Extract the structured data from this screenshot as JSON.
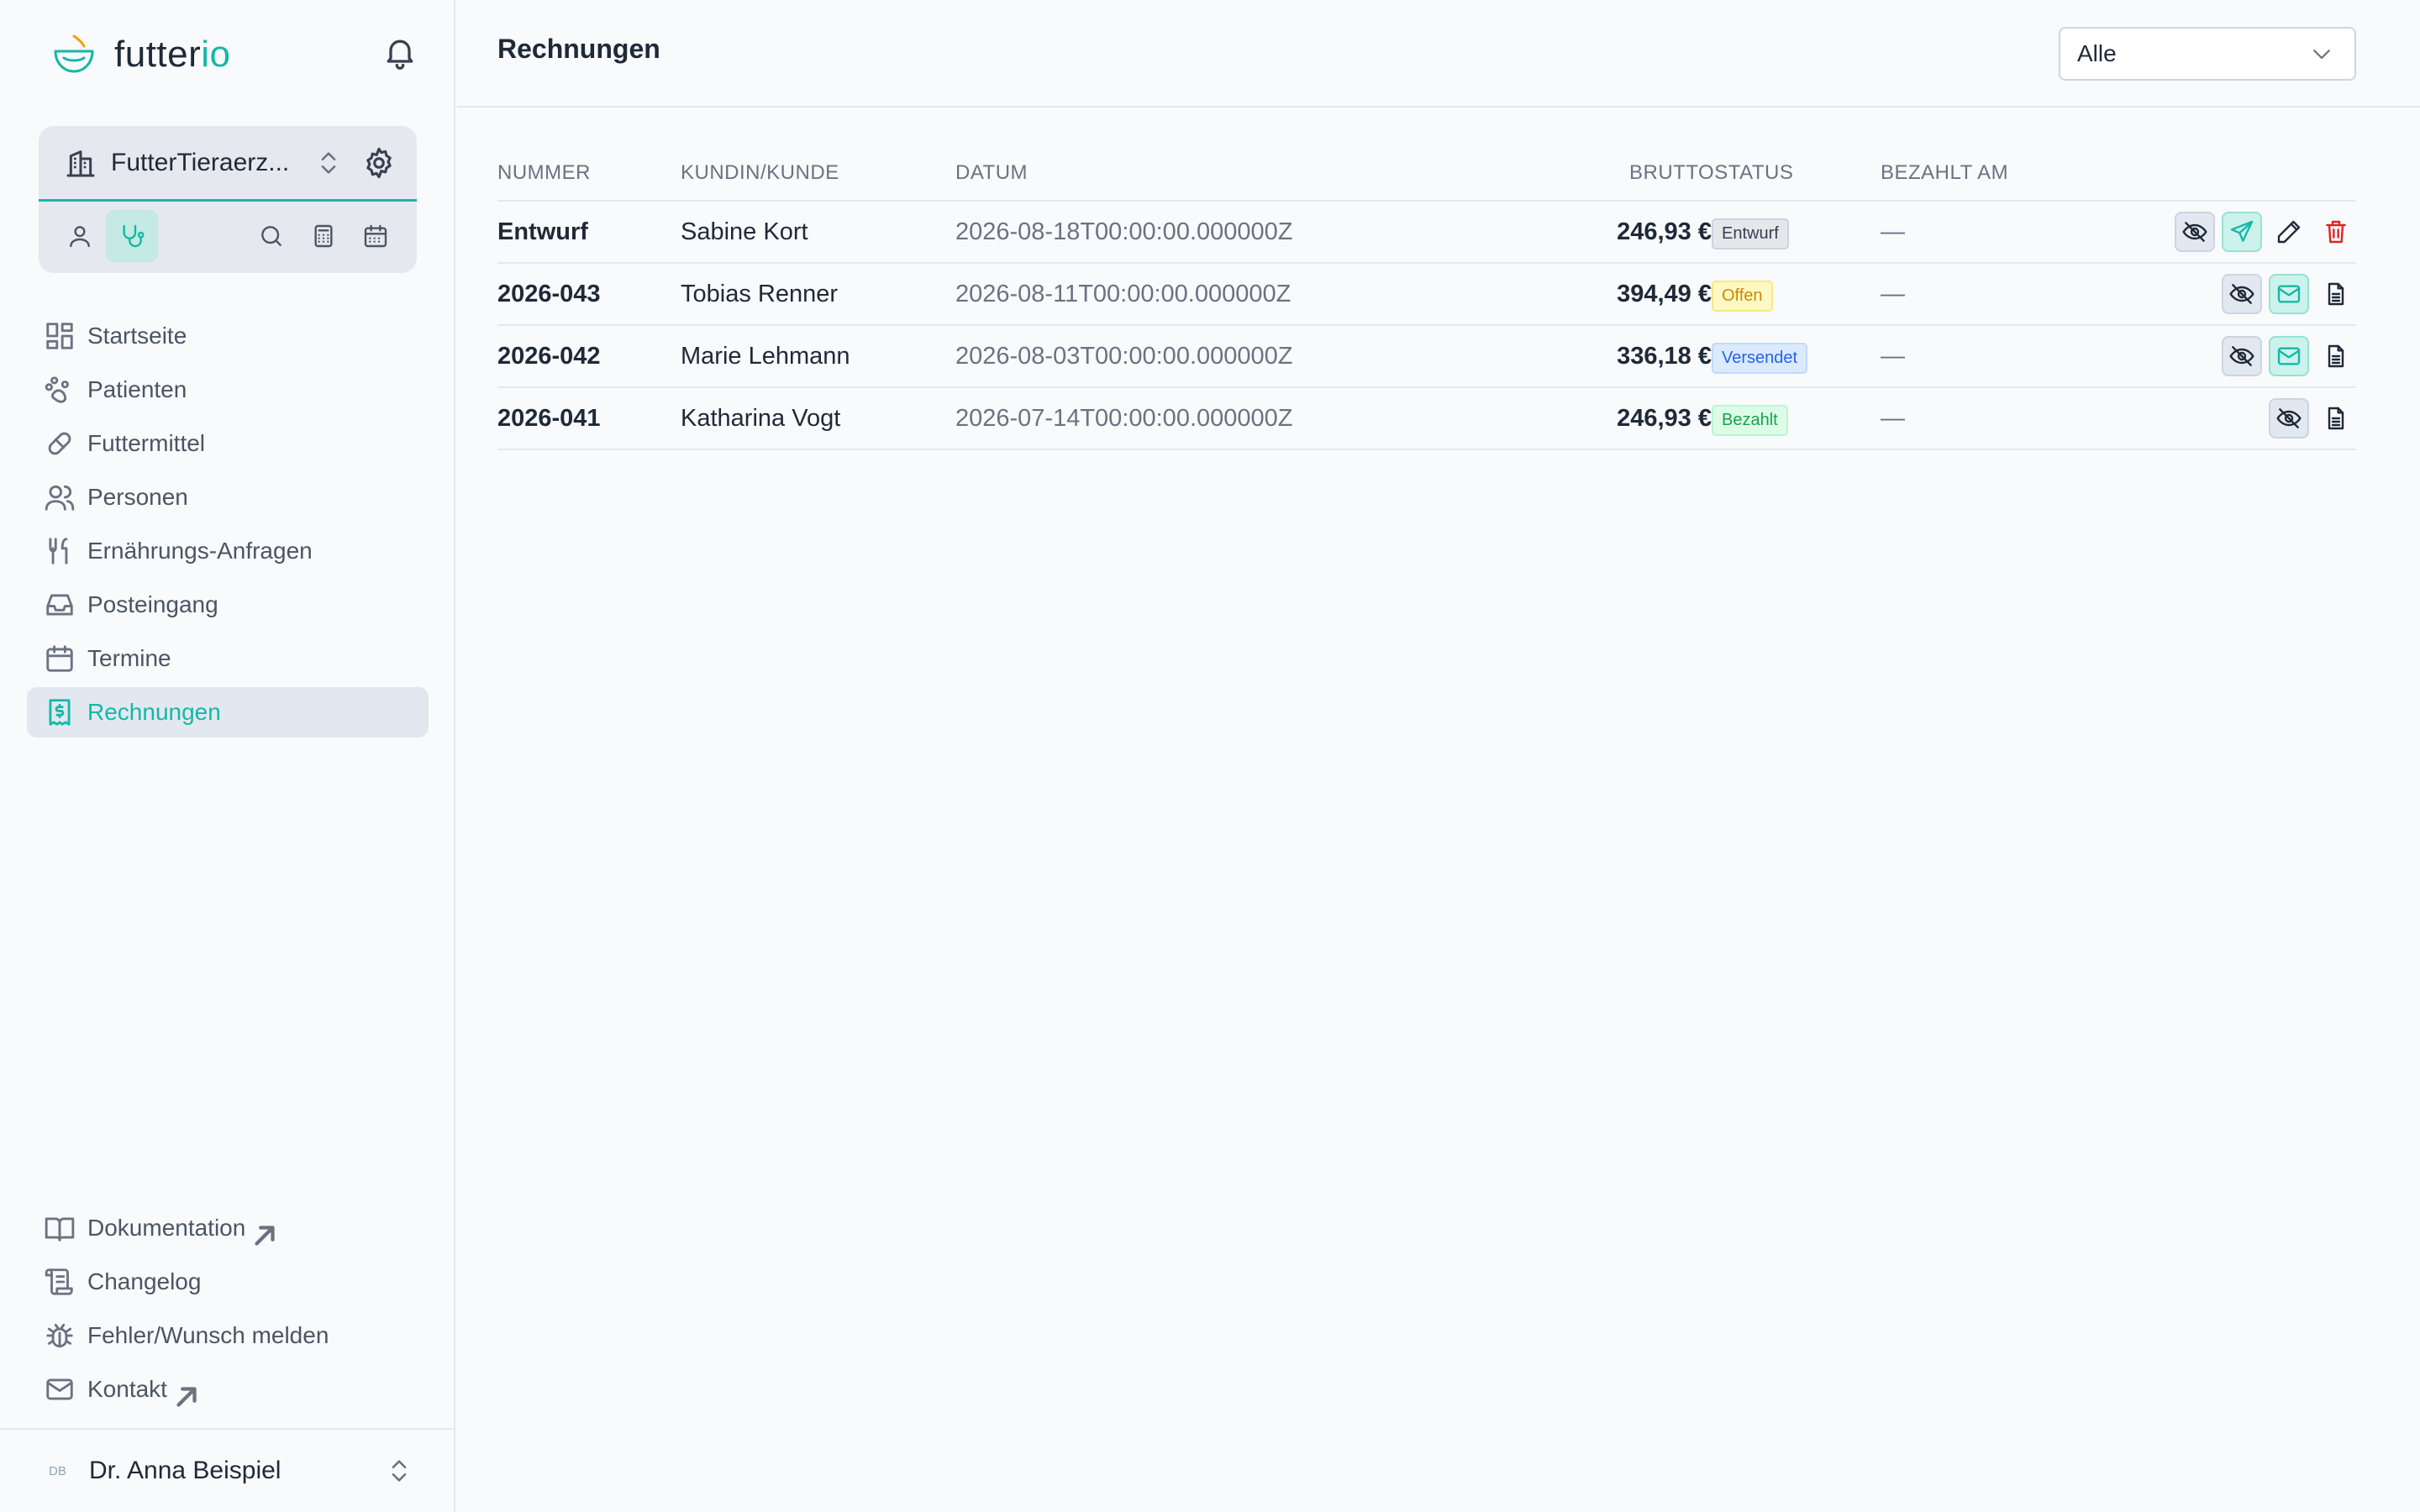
{
  "brand": {
    "name_main": "futter",
    "name_accent": "io"
  },
  "org": {
    "name": "FutterTieraerz..."
  },
  "nav": {
    "items": [
      {
        "label": "Startseite"
      },
      {
        "label": "Patienten"
      },
      {
        "label": "Futtermittel"
      },
      {
        "label": "Personen"
      },
      {
        "label": "Ernährungs-Anfragen"
      },
      {
        "label": "Posteingang"
      },
      {
        "label": "Termine"
      },
      {
        "label": "Rechnungen"
      }
    ],
    "bottom": [
      {
        "label": "Dokumentation"
      },
      {
        "label": "Changelog"
      },
      {
        "label": "Fehler/Wunsch melden"
      },
      {
        "label": "Kontakt"
      }
    ]
  },
  "user": {
    "initials": "DB",
    "name": "Dr. Anna Beispiel"
  },
  "page": {
    "title": "Rechnungen",
    "filter_value": "Alle"
  },
  "table": {
    "headers": {
      "nummer": "NUMMER",
      "kunde": "KUNDIN/KUNDE",
      "datum": "DATUM",
      "brutto_status": "BRUTTOSTATUS",
      "bezahlt": "BEZAHLT AM"
    },
    "rows": [
      {
        "nummer": "Entwurf",
        "kunde": "Sabine Kort",
        "datum": "2026-08-18T00:00:00.000000Z",
        "betrag": "246,93 €",
        "status": "Entwurf",
        "bezahlt": "—"
      },
      {
        "nummer": "2026-043",
        "kunde": "Tobias Renner",
        "datum": "2026-08-11T00:00:00.000000Z",
        "betrag": "394,49 €",
        "status": "Offen",
        "bezahlt": "—"
      },
      {
        "nummer": "2026-042",
        "kunde": "Marie Lehmann",
        "datum": "2026-08-03T00:00:00.000000Z",
        "betrag": "336,18 €",
        "status": "Versendet",
        "bezahlt": "—"
      },
      {
        "nummer": "2026-041",
        "kunde": "Katharina Vogt",
        "datum": "2026-07-14T00:00:00.000000Z",
        "betrag": "246,93 €",
        "status": "Bezahlt",
        "bezahlt": "—"
      }
    ]
  },
  "colors": {
    "accent": "#14b8a6",
    "status_entwurf": "#374151",
    "status_offen": "#ca8a04",
    "status_versendet": "#2563eb",
    "status_bezahlt": "#16a34a",
    "delete": "#dc2626"
  }
}
